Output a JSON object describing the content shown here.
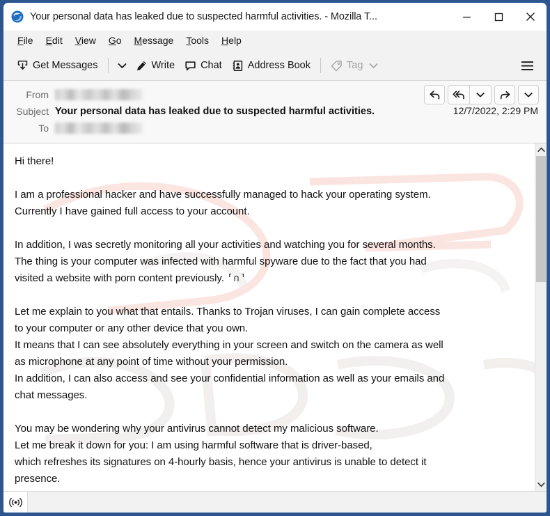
{
  "window": {
    "title": "Your personal data has leaked due to suspected harmful activities. - Mozilla T...",
    "app_icon": "thunderbird-icon",
    "border_color": "#2d5691",
    "controls": {
      "minimize": "minimize-icon",
      "maximize": "maximize-icon",
      "close": "close-icon"
    }
  },
  "menubar": {
    "items": [
      {
        "label": "File",
        "accesskey": "F"
      },
      {
        "label": "Edit",
        "accesskey": "E"
      },
      {
        "label": "View",
        "accesskey": "V"
      },
      {
        "label": "Go",
        "accesskey": "G"
      },
      {
        "label": "Message",
        "accesskey": "M"
      },
      {
        "label": "Tools",
        "accesskey": "T"
      },
      {
        "label": "Help",
        "accesskey": "H"
      }
    ]
  },
  "toolbar": {
    "get_messages_label": "Get Messages",
    "get_messages_icon": "download-inbox-icon",
    "get_messages_caret": "chevron-down-icon",
    "write_label": "Write",
    "write_icon": "pencil-icon",
    "chat_label": "Chat",
    "chat_icon": "chat-bubble-icon",
    "address_book_label": "Address Book",
    "address_book_icon": "address-book-icon",
    "tag_label": "Tag",
    "tag_icon": "tag-icon",
    "tag_caret": "chevron-down-icon",
    "tag_disabled": true,
    "app_menu_icon": "hamburger-menu-icon"
  },
  "message_header": {
    "from_label": "From",
    "from_value": "",
    "from_redacted": true,
    "subject_label": "Subject",
    "subject_value": "Your personal data has leaked due to suspected harmful activities.",
    "to_label": "To",
    "to_value": "",
    "to_redacted": true,
    "date": "12/7/2022, 2:29 PM",
    "actions": [
      {
        "name": "reply-button",
        "icon": "reply-arrow-icon"
      },
      {
        "name": "reply-all-button",
        "icon": "reply-all-arrow-icon"
      },
      {
        "name": "reply-more-button",
        "icon": "chevron-down-icon"
      },
      {
        "name": "forward-button",
        "icon": "forward-arrow-icon"
      },
      {
        "name": "more-actions-button",
        "icon": "chevron-down-icon"
      }
    ]
  },
  "message_body": {
    "text": "Hi there!\n\nI am a professional hacker and have successfully managed to hack your operating system.\nCurrently I have gained full access to your account.\n\nIn addition, I was secretly monitoring all your activities and watching you for several months.\nThe thing is your computer was infected with harmful spyware due to the fact that you had\nvisited a website with porn content previously. ",
    "broken_glyph": "⸢∩⸣",
    "text_after_glyph": "\n\nLet me explain to you what that entails. Thanks to Trojan viruses, I can gain complete access\nto your computer or any other device that you own.\nIt means that I can see absolutely everything in your screen and switch on the camera as well\nas microphone at any point of time without your permission.\nIn addition, I can also access and see your confidential information as well as your emails and\nchat messages.\n\nYou may be wondering why your antivirus cannot detect my malicious software.\nLet me break it down for you: I am using harmful software that is driver-based,\nwhich refreshes its signatures on 4-hourly basis, hence your antivirus is unable to detect it\npresence.",
    "watermark": "PCrisk.com"
  },
  "scrollbar": {
    "up_icon": "chevron-up-icon",
    "down_icon": "chevron-down-icon",
    "thumb_position_percent": 0,
    "thumb_size_percent": 39
  },
  "statusbar": {
    "icon": "broadcast-online-icon",
    "text": ""
  }
}
